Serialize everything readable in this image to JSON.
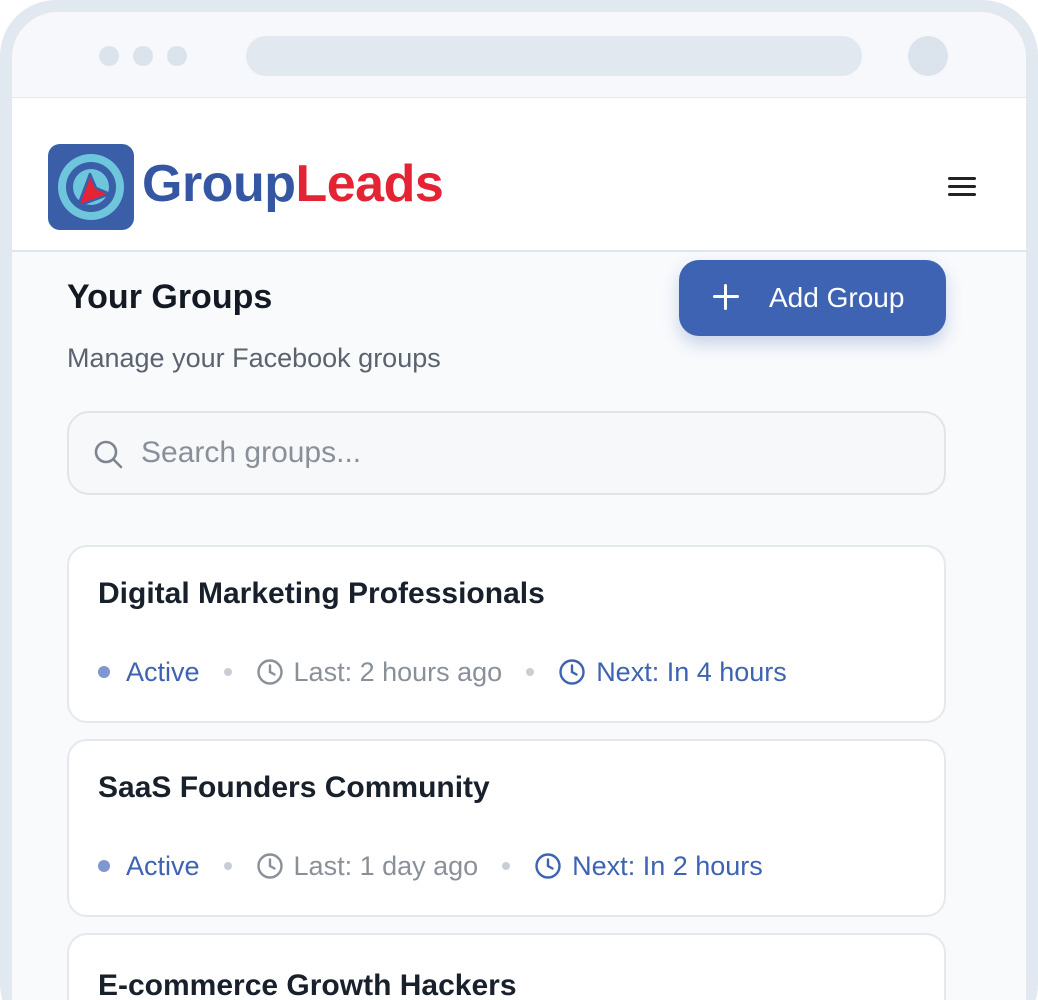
{
  "app": {
    "brand_part1": "Group",
    "brand_part2": "Leads",
    "brand_colors": {
      "primary": "#3556a3",
      "accent": "#e42334"
    }
  },
  "page": {
    "title": "Your Groups",
    "subtitle": "Manage your Facebook groups",
    "add_button_label": "Add Group"
  },
  "search": {
    "placeholder": "Search groups...",
    "value": ""
  },
  "groups": [
    {
      "name": "Digital Marketing Professionals",
      "status": "Active",
      "last": "Last: 2 hours ago",
      "next": "Next: In 4 hours"
    },
    {
      "name": "SaaS Founders Community",
      "status": "Active",
      "last": "Last: 1 day ago",
      "next": "Next: In 2 hours"
    },
    {
      "name": "E-commerce Growth Hackers"
    }
  ],
  "icons": {
    "logo": "location-arrow-logo-icon",
    "menu": "hamburger-menu-icon",
    "add": "plus-icon",
    "search": "search-icon",
    "time": "clock-icon"
  }
}
